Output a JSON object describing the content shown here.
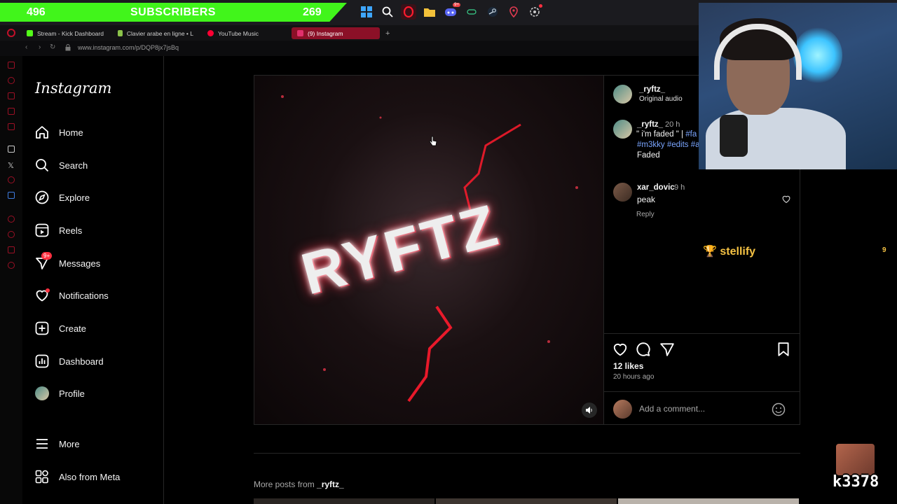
{
  "overlay": {
    "subscribers_left": "496",
    "subscribers_label": "SUBSCRIBERS",
    "subscribers_right": "269",
    "stellify_label": "stellify",
    "stellify_count": "9",
    "emote_text": "k3378"
  },
  "taskbar": {
    "icons": [
      "windows-icon",
      "search-icon",
      "opera-icon",
      "folder-icon",
      "discord-icon",
      "app-icon",
      "steam-icon",
      "map-pin-icon",
      "settings-icon"
    ],
    "discord_badge": "9+"
  },
  "browser": {
    "tabs": [
      {
        "label": "Stream - Kick Dashboard",
        "color": "#53fc18"
      },
      {
        "label": "Clavier arabe en ligne • L",
        "color": "#8bc34a"
      },
      {
        "label": "YouTube Music",
        "color": "#ff0033"
      },
      {
        "label": "(9) Instagram",
        "color": "#e1306c"
      }
    ],
    "new_tab": "+",
    "url": "www.instagram.com/p/DQP8jx7jsBq"
  },
  "instagram": {
    "logo": "Instagram",
    "nav": [
      {
        "label": "Home",
        "icon": "home-icon"
      },
      {
        "label": "Search",
        "icon": "search-icon"
      },
      {
        "label": "Explore",
        "icon": "compass-icon"
      },
      {
        "label": "Reels",
        "icon": "reels-icon"
      },
      {
        "label": "Messages",
        "icon": "send-icon",
        "badge": "9+"
      },
      {
        "label": "Notifications",
        "icon": "heart-icon"
      },
      {
        "label": "Create",
        "icon": "plus-square-icon"
      },
      {
        "label": "Dashboard",
        "icon": "chart-icon"
      },
      {
        "label": "Profile",
        "icon": "avatar-icon"
      },
      {
        "label": "More",
        "icon": "menu-icon"
      },
      {
        "label": "Also from Meta",
        "icon": "meta-icon"
      }
    ],
    "media_text": "RYFTZ",
    "post": {
      "author": "_ryftz_",
      "audio": "Original audio",
      "caption_author": "_ryftz_",
      "caption_time": "20 h",
      "caption_line1": "\" i'm faded \" | ",
      "caption_tag1": "#fa",
      "caption_line2_tag1": "#m3kky",
      "caption_line2_tag2": "#edits",
      "caption_line2_tag3": "#a",
      "caption_line3": "Faded",
      "comment_author": "xar_dovic",
      "comment_time": "9 h",
      "comment_text": "peak",
      "reply_label": "Reply",
      "likes": "12 likes",
      "ago": "20 hours ago",
      "comment_placeholder": "Add a comment..."
    },
    "more_posts_prefix": "More posts from ",
    "more_posts_user": "_ryftz_"
  }
}
